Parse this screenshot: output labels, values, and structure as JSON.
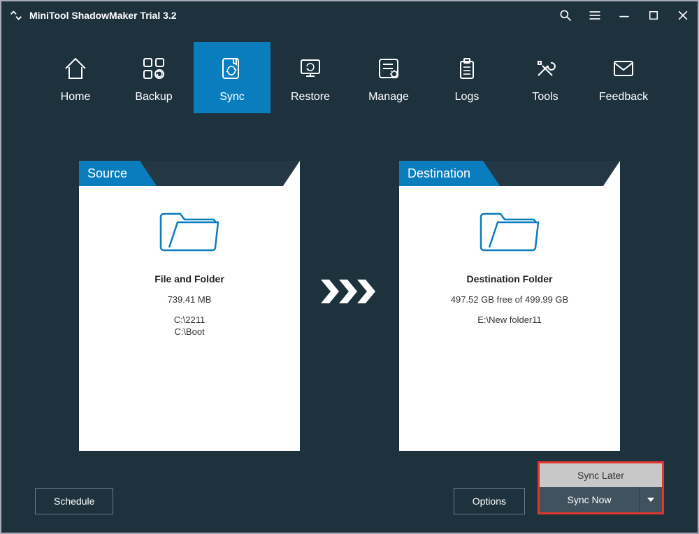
{
  "app_title": "MiniTool ShadowMaker Trial 3.2",
  "nav": [
    {
      "label": "Home"
    },
    {
      "label": "Backup"
    },
    {
      "label": "Sync"
    },
    {
      "label": "Restore"
    },
    {
      "label": "Manage"
    },
    {
      "label": "Logs"
    },
    {
      "label": "Tools"
    },
    {
      "label": "Feedback"
    }
  ],
  "source": {
    "tab": "Source",
    "title": "File and Folder",
    "size": "739.41 MB",
    "paths": [
      "C:\\2211",
      "C:\\Boot"
    ]
  },
  "destination": {
    "tab": "Destination",
    "title": "Destination Folder",
    "free": "497.52 GB free of 499.99 GB",
    "path": "E:\\New folder11"
  },
  "footer": {
    "schedule": "Schedule",
    "options": "Options",
    "sync_later": "Sync Later",
    "sync_now": "Sync Now"
  }
}
